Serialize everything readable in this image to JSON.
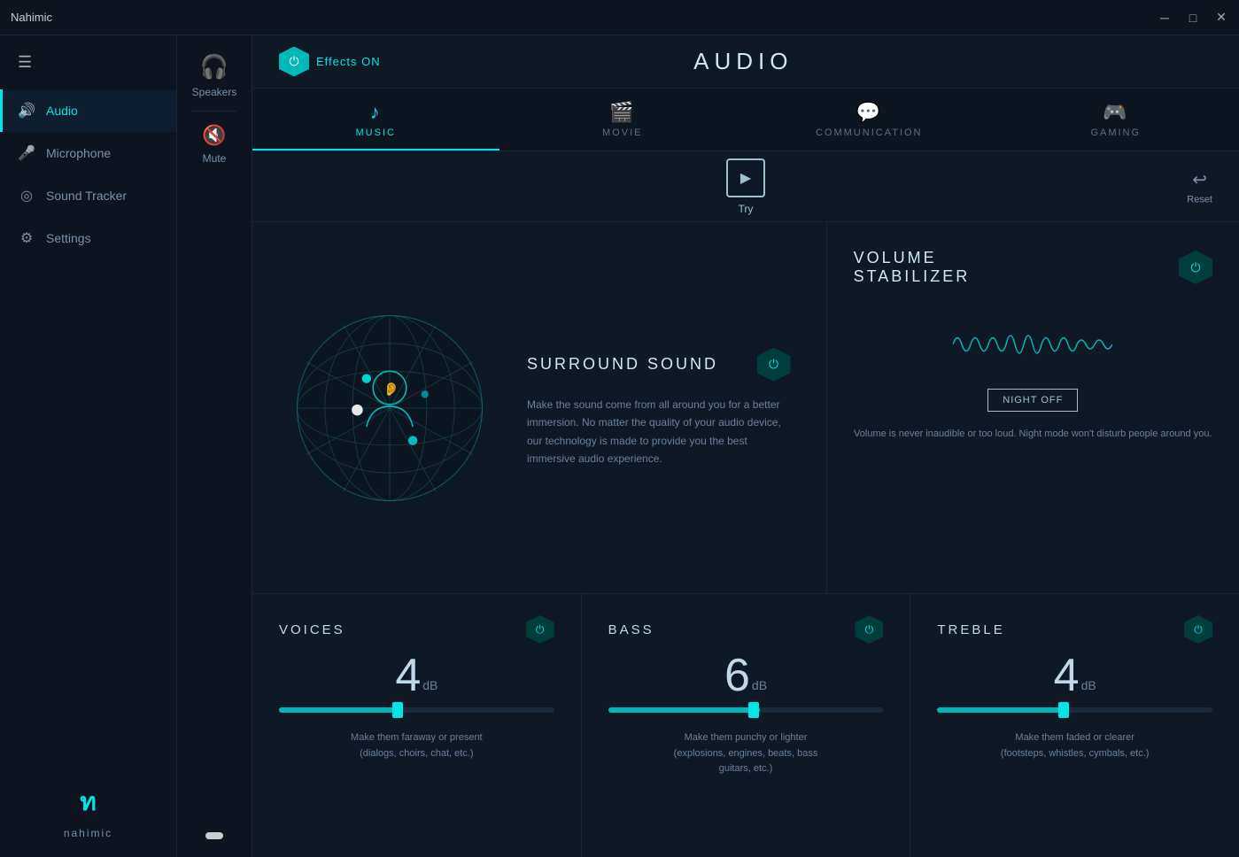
{
  "titlebar": {
    "app_name": "Nahimic",
    "min_label": "─",
    "max_label": "□",
    "close_label": "✕"
  },
  "sidebar": {
    "hamburger": "☰",
    "items": [
      {
        "id": "audio",
        "label": "Audio",
        "icon": "🔊",
        "active": true
      },
      {
        "id": "microphone",
        "label": "Microphone",
        "icon": "🎤",
        "active": false
      },
      {
        "id": "sound-tracker",
        "label": "Sound Tracker",
        "icon": "◎",
        "active": false
      },
      {
        "id": "settings",
        "label": "Settings",
        "icon": "⚙",
        "active": false
      }
    ],
    "logo_symbol": "ท",
    "logo_text": "nahimic"
  },
  "speakers_panel": {
    "speakers_icon": "🎧",
    "speakers_label": "Speakers",
    "mute_icon": "🔇",
    "mute_label": "Mute"
  },
  "header": {
    "effects_label": "Effects ON",
    "page_title": "AUDIO",
    "reset_label": "Reset"
  },
  "tabs": [
    {
      "id": "music",
      "label": "MUSIC",
      "icon": "♪",
      "active": true
    },
    {
      "id": "movie",
      "label": "MOVIE",
      "icon": "🎬",
      "active": false
    },
    {
      "id": "communication",
      "label": "COMMUNICATION",
      "icon": "💬",
      "active": false
    },
    {
      "id": "gaming",
      "label": "GAMING",
      "icon": "🎮",
      "active": false
    }
  ],
  "try_reset": {
    "try_label": "Try",
    "reset_label": "Reset"
  },
  "surround_sound": {
    "title": "SURROUND SOUND",
    "description": "Make the sound come from all around you for a better immersion. No matter the quality of your audio device, our technology is made to provide you the best immersive audio experience."
  },
  "volume_stabilizer": {
    "title": "VOLUME\nSTABILIZER",
    "night_off_label": "NIGHT OFF",
    "description": "Volume is never inaudible or too loud. Night mode won't disturb people around you."
  },
  "sliders": [
    {
      "id": "voices",
      "title": "VOICES",
      "value": "4",
      "unit": "dB",
      "fill_percent": 45,
      "thumb_percent": 43,
      "description": "Make them faraway or present\n(dialogs, choirs, chat, etc.)"
    },
    {
      "id": "bass",
      "title": "BASS",
      "value": "6",
      "unit": "dB",
      "fill_percent": 55,
      "thumb_percent": 53,
      "description": "Make them punchy or lighter\n(explosions, engines, beats, bass\nguitars, etc.)"
    },
    {
      "id": "treble",
      "title": "TREBLE",
      "value": "4",
      "unit": "dB",
      "fill_percent": 48,
      "thumb_percent": 46,
      "description": "Make them faded or clearer\n(footsteps, whistles, cymbals, etc.)"
    }
  ]
}
